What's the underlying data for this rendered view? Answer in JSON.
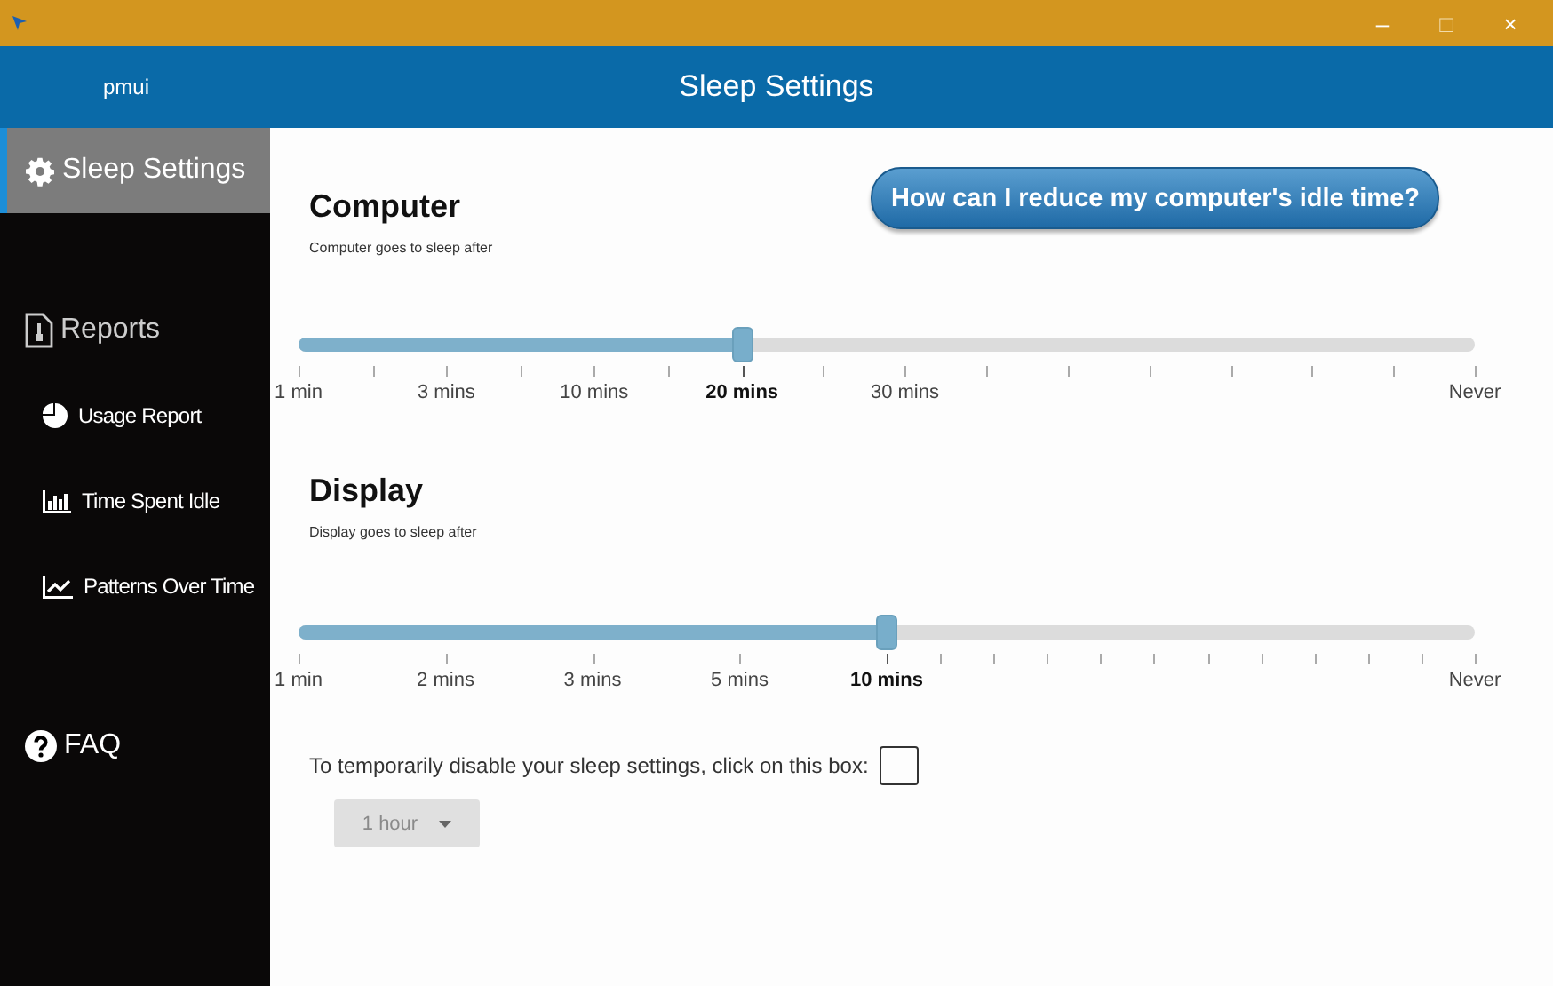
{
  "window": {
    "controls": [
      "–",
      "□",
      "×"
    ]
  },
  "header": {
    "app_name": "pmui",
    "title": "Sleep Settings"
  },
  "sidebar": {
    "items": [
      {
        "kind": "gear",
        "label": "Sleep Settings",
        "selected": true
      },
      {
        "kind": "report",
        "label": "Reports",
        "selected": false
      },
      {
        "kind": "pie",
        "label": "Usage Report",
        "selected": false
      },
      {
        "kind": "bars",
        "label": "Time Spent Idle",
        "selected": false
      },
      {
        "kind": "trend",
        "label": "Patterns Over Time",
        "selected": false
      },
      {
        "kind": "help",
        "label": "FAQ",
        "selected": false
      }
    ]
  },
  "help_button": "How can I reduce my computer's idle time?",
  "sections": [
    {
      "title": "Computer",
      "caption": "Computer goes to sleep after",
      "level": 0.377,
      "ticks": [
        {
          "label": "1 min",
          "selected": false
        },
        {
          "selected": false
        },
        {
          "label": "3 mins",
          "selected": false
        },
        {
          "selected": false
        },
        {
          "label": "10 mins",
          "selected": false
        },
        {
          "selected": false
        },
        {
          "label": "20 mins",
          "selected": true
        },
        {
          "selected": false
        },
        {
          "label": "30 mins",
          "selected": false
        },
        {
          "selected": false
        },
        {
          "selected": false
        },
        {
          "selected": false
        },
        {
          "selected": false
        },
        {
          "selected": false
        },
        {
          "selected": false
        },
        {
          "label": "Never",
          "selected": false
        }
      ]
    },
    {
      "title": "Display",
      "caption": "Display goes to sleep after",
      "level": 0.5,
      "ticks": [
        {
          "label": "1 min",
          "selected": false
        },
        {
          "label": "2 mins",
          "selected": false
        },
        {
          "label": "3 mins",
          "selected": false
        },
        {
          "label": "5 mins",
          "selected": false
        },
        {
          "label": "10 mins",
          "selected": true
        },
        {
          "selected": false
        },
        {
          "selected": false
        },
        {
          "selected": false
        },
        {
          "selected": false
        },
        {
          "selected": false
        },
        {
          "selected": false
        },
        {
          "selected": false
        },
        {
          "selected": false
        },
        {
          "selected": false
        },
        {
          "selected": false
        },
        {
          "label": "Never",
          "selected": false
        }
      ]
    }
  ],
  "disable": {
    "label": "To temporarily disable your sleep settings, click on this box:",
    "checked": false
  },
  "duration": {
    "value": "1 hour",
    "disabled": true
  }
}
